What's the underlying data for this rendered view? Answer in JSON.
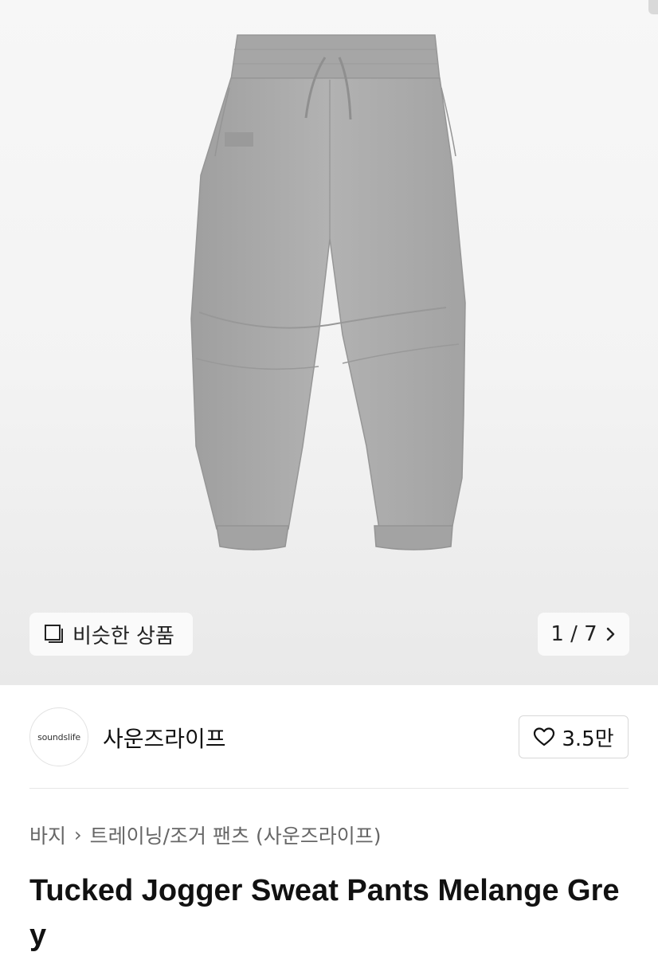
{
  "gallery": {
    "similar_label": "비슷한 상품",
    "pager_text": "1 / 7",
    "next_icon": "chevron-right-icon",
    "similar_icon": "stack-icon",
    "product_image_alt": "grey jogger sweat pants"
  },
  "brand": {
    "logo_text": "soundslife",
    "name": "사운즈라이프",
    "likes": "3.5만",
    "like_icon": "heart-icon"
  },
  "breadcrumb": {
    "category": "바지",
    "subcategory": "트레이닝/조거 팬츠 (사운즈라이프)"
  },
  "product": {
    "title": "Tucked Jogger Sweat Pants Melange Grey"
  },
  "colors": {
    "pants": "#a9a9a9",
    "hero_bg": "#f3f3f3",
    "text_muted": "#666666"
  }
}
